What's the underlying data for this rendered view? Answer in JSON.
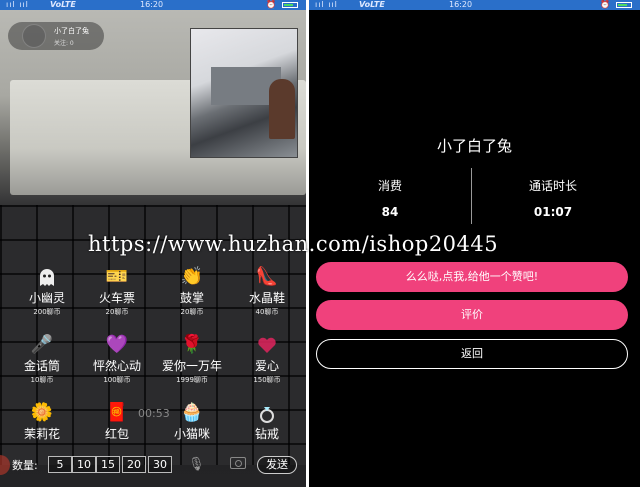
{
  "status_bar": {
    "signal": "ııl ııl",
    "volte": "VoLTE",
    "time": "16:20",
    "alarm": "⏰"
  },
  "call_screen": {
    "anchor_name": "小了白了兔",
    "anchor_follow": "关注: 0",
    "timer": "00:53",
    "gifts": [
      {
        "icon": "train-ticket-icon",
        "glyph": "🎫",
        "name": "小幽灵",
        "price": "200聊币"
      },
      {
        "icon": "train-ticket-icon",
        "glyph": "🎫",
        "name": "火车票",
        "price": "20聊币"
      },
      {
        "icon": "applause-icon",
        "glyph": "👏",
        "name": "鼓掌",
        "price": "20聊币"
      },
      {
        "icon": "crystal-shoe-icon",
        "glyph": "👠",
        "name": "水晶鞋",
        "price": "40聊币"
      },
      {
        "icon": "microphone-icon",
        "glyph": "🎤",
        "name": "金话筒",
        "price": "10聊币"
      },
      {
        "icon": "heartbeat-icon",
        "glyph": "💜",
        "name": "怦然心动",
        "price": "100聊币"
      },
      {
        "icon": "roses-icon",
        "glyph": "🌹",
        "name": "爱你一万年",
        "price": "1999聊币"
      },
      {
        "icon": "heart-icon",
        "glyph": "",
        "name": "爱心",
        "price": "150聊币"
      },
      {
        "icon": "jasmine-icon",
        "glyph": "🌼",
        "name": "茉莉花",
        "price": ""
      },
      {
        "icon": "red-envelope-icon",
        "glyph": "🧧",
        "name": "红包",
        "price": ""
      },
      {
        "icon": "cat-icon",
        "glyph": "🧁",
        "name": "小猫咪",
        "price": ""
      },
      {
        "icon": "diamond-ring-icon",
        "glyph": "",
        "name": "钻戒",
        "price": ""
      }
    ],
    "quantity_label": "数量:",
    "quantities": [
      "5",
      "10",
      "15",
      "20",
      "30"
    ],
    "send_label": "发送"
  },
  "watermark": "https://www.huzhan.com/ishop20445",
  "summary_screen": {
    "name": "小了白了兔",
    "stats": [
      {
        "label": "消费",
        "value": "84"
      },
      {
        "label": "通话时长",
        "value": "01:07"
      }
    ],
    "like_button": "么么哒,点我,给他一个赞吧!",
    "rate_button": "评价",
    "back_button": "返回"
  }
}
